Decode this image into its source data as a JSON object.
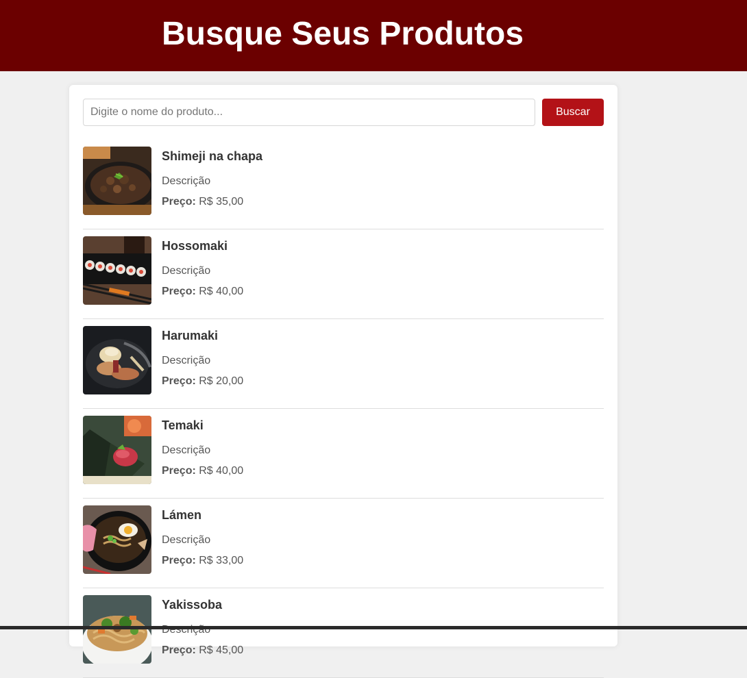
{
  "header": {
    "title": "Busque Seus Produtos"
  },
  "search": {
    "placeholder": "Digite o nome do produto...",
    "value": "",
    "button_label": "Buscar"
  },
  "colors": {
    "header_bg": "#6b0000",
    "accent": "#b31217",
    "page_bg": "#f0f0f0"
  },
  "products": [
    {
      "name": "Shimeji na chapa",
      "description": "Descrição",
      "price_label": "Preço:",
      "price": "R$ 35,00",
      "image_icon": "shimeji-dish-photo"
    },
    {
      "name": "Hossomaki",
      "description": "Descrição",
      "price_label": "Preço:",
      "price": "R$ 40,00",
      "image_icon": "hossomaki-photo"
    },
    {
      "name": "Harumaki",
      "description": "Descrição",
      "price_label": "Preço:",
      "price": "R$ 20,00",
      "image_icon": "harumaki-photo"
    },
    {
      "name": "Temaki",
      "description": "Descrição",
      "price_label": "Preço:",
      "price": "R$ 40,00",
      "image_icon": "temaki-photo"
    },
    {
      "name": "Lámen",
      "description": "Descrição",
      "price_label": "Preço:",
      "price": "R$ 33,00",
      "image_icon": "lamen-photo"
    },
    {
      "name": "Yakissoba",
      "description": "Descrição",
      "price_label": "Preço:",
      "price": "R$ 45,00",
      "image_icon": "yakissoba-photo"
    }
  ]
}
